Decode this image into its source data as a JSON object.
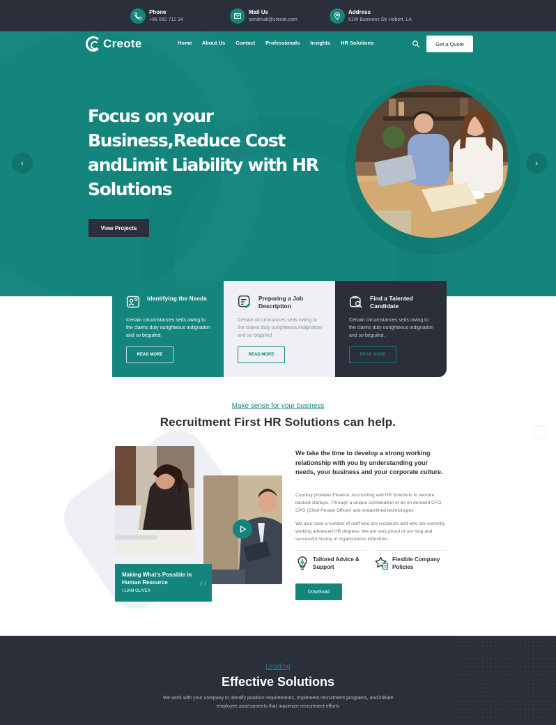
{
  "topbar": {
    "phone": {
      "label": "Phone",
      "value": "+98 060 712 34",
      "icon": "phone-icon"
    },
    "mail": {
      "label": "Mail Us",
      "value": "sendmail@creote.com",
      "icon": "mail-icon"
    },
    "address": {
      "label": "Address",
      "value": "61W Business Str Hobert, LA",
      "icon": "location-pin-icon"
    }
  },
  "header": {
    "logo_text": "Creote",
    "nav": [
      "Home",
      "About Us",
      "Contact",
      "Professionals",
      "Insights",
      "HR Solutions"
    ],
    "quote_button": "Get a Quote"
  },
  "hero": {
    "headline": "Focus on your Business,Reduce Cost andLimit Liability with HR Solutions",
    "button": "View Projects",
    "prev_arrow": "‹",
    "next_arrow": "›"
  },
  "cards": [
    {
      "title": "Identifying the Needs",
      "desc": "Certain circumstances seds owing to the claims duty ourighteous indignation and so beguiled.",
      "button": "READ MORE",
      "icon": "needs-icon"
    },
    {
      "title": "Preparing a Job Description",
      "desc": "Certain circumstances seds owing to the claims duty ourighteous indignation and so beguiled.",
      "button": "READ MORE",
      "icon": "job-description-icon"
    },
    {
      "title": "Find a Talented Candidate",
      "desc": "Certain circumstances seds owing to the claims duty ourighteous indignation and so beguiled.",
      "button": "READ MORE",
      "icon": "candidate-search-icon"
    }
  ],
  "about": {
    "subtitle": "Make sense for your business",
    "title": "Recruitment First HR Solutions can help.",
    "quote_title": "Making What's Possible in Human Resource",
    "quote_author": "/ LIAM OLIVER",
    "quote_mark": "“",
    "lead": "We take the time to develop a strong working relationship with you by understanding your needs, your business and your corporate culture.",
    "para1": "Countsy provides Finance, Accounting and HR Solutions to venture backed startups. Through a unique combination of an on demand CFO, CPO (Chief People Officer) and streamlined technologies",
    "para2": "We also have a number of staff who are recipients and who are currently working advanced HR degrees. We are very proud of our long and successful history of organizations industries .",
    "features": [
      {
        "label": "Tailored Advice & Support",
        "icon": "lightbulb-icon"
      },
      {
        "label": "Flexible Company Policies",
        "icon": "star-document-icon"
      }
    ],
    "download_button": "Download"
  },
  "solutions": {
    "subtitle": "Leading",
    "title": "Effective Solutions",
    "desc": "We work with your company to identify position requirements, implement recruitment programs, and initiate employee assessments that maximize recruitment efforts"
  },
  "colors": {
    "teal": "#13857c",
    "dark": "#2b2f3a",
    "light": "#eef0f5"
  }
}
